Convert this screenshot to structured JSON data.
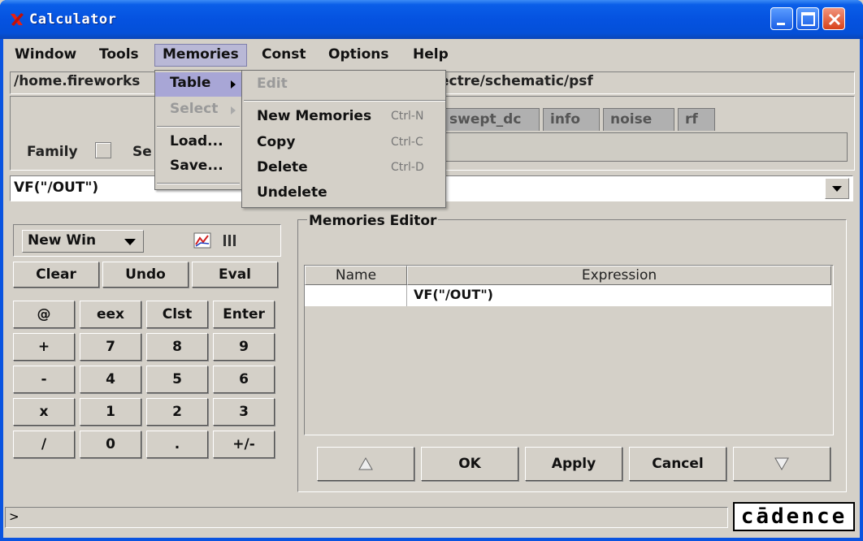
{
  "window": {
    "title": "Calculator"
  },
  "menubar": [
    "Window",
    "Tools",
    "Memories",
    "Const",
    "Options",
    "Help"
  ],
  "path": {
    "left": "/home.fireworks",
    "right": "ectre/schematic/psf"
  },
  "upper": {
    "family_label": "Family",
    "se_label": "Se"
  },
  "tabs": [
    "swept_dc",
    "info",
    "noise",
    "rf"
  ],
  "expression": "VF(\"/OUT\")",
  "left_panel": {
    "newwin": "New Win",
    "row1": [
      "Clear",
      "Undo",
      "Eval"
    ],
    "keys": [
      [
        "@",
        "eex",
        "Clst",
        "Enter"
      ],
      [
        "+",
        "7",
        "8",
        "9"
      ],
      [
        "-",
        "4",
        "5",
        "6"
      ],
      [
        "x",
        "1",
        "2",
        "3"
      ],
      [
        "/",
        "0",
        ".",
        "+/-"
      ]
    ]
  },
  "memories_editor": {
    "title": "Memories Editor",
    "columns": [
      "Name",
      "Expression"
    ],
    "rows": [
      {
        "name": "",
        "expression": "VF(\"/OUT\")"
      }
    ],
    "buttons": {
      "ok": "OK",
      "apply": "Apply",
      "cancel": "Cancel"
    }
  },
  "status": {
    "prompt": ">",
    "logo": "cādence"
  },
  "memories_menu": {
    "items": [
      "Table",
      "Select",
      "Load...",
      "Save..."
    ]
  },
  "table_submenu": {
    "edit": "Edit",
    "items": [
      {
        "label": "New Memories",
        "shortcut": "Ctrl-N"
      },
      {
        "label": "Copy",
        "shortcut": "Ctrl-C"
      },
      {
        "label": "Delete",
        "shortcut": "Ctrl-D"
      },
      {
        "label": "Undelete",
        "shortcut": ""
      }
    ]
  }
}
